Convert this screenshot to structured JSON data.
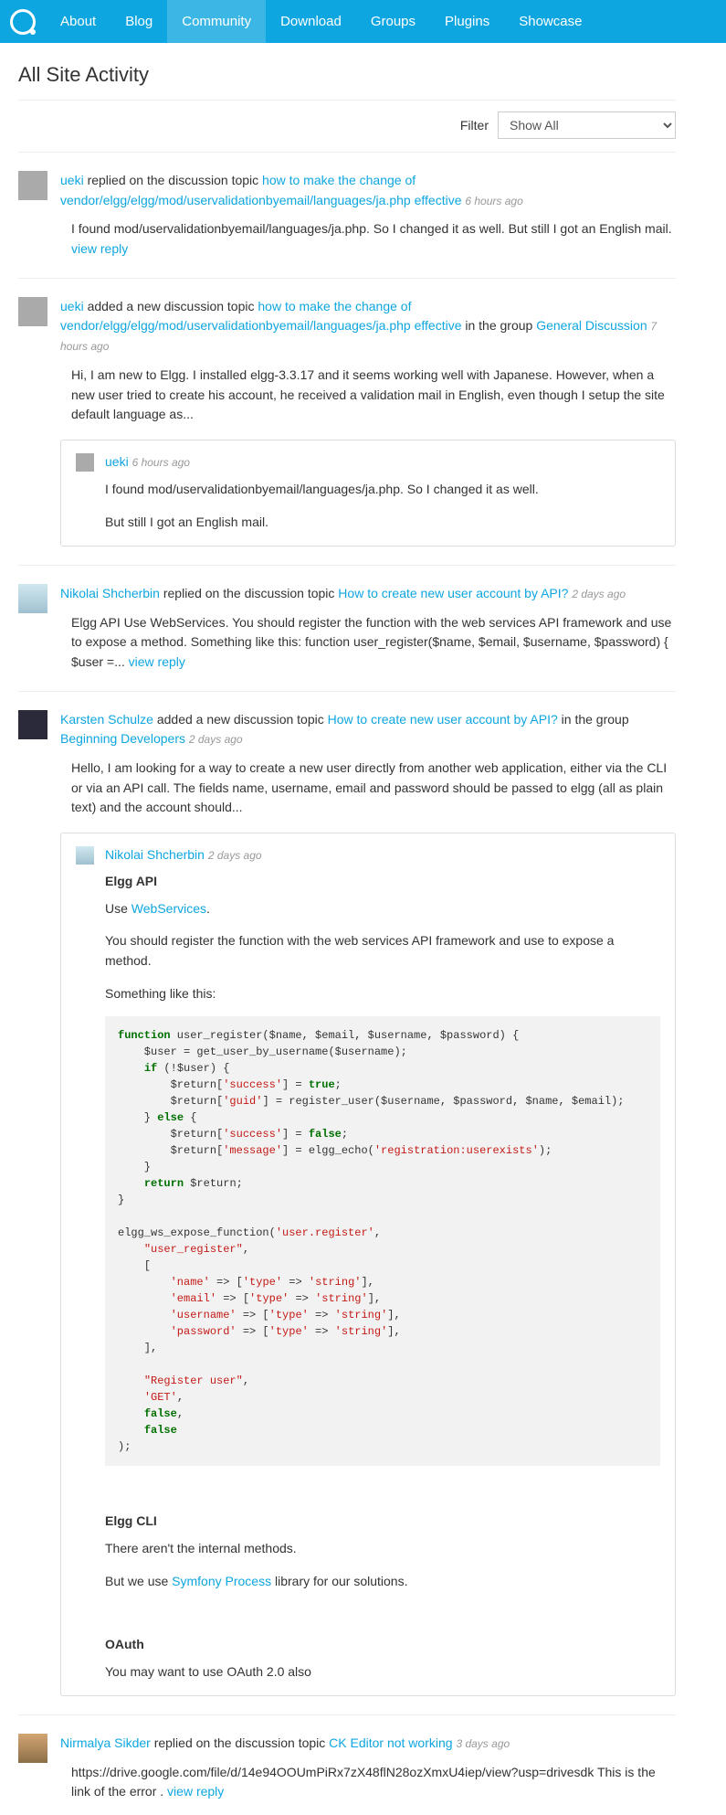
{
  "nav": {
    "items": [
      "About",
      "Blog",
      "Community",
      "Download",
      "Groups",
      "Plugins",
      "Showcase"
    ],
    "active_index": 2
  },
  "page_title": "All Site Activity",
  "filter": {
    "label": "Filter",
    "selected": "Show All"
  },
  "activity": [
    {
      "avatar": "default",
      "user": "ueki",
      "action": " replied on the discussion topic ",
      "topic": "how to make the change of vendor/elgg/elgg/mod/uservalidationbyemail/languages/ja.php effective",
      "time": "6 hours ago",
      "excerpt_pre": "I found mod/uservalidationbyemail/languages/ja.php. So I changed it as well. But still I got an English mail. ",
      "view_reply": "view reply"
    },
    {
      "avatar": "default",
      "user": "ueki",
      "action": " added a new discussion topic ",
      "topic": "how to make the change of vendor/elgg/elgg/mod/uservalidationbyemail/languages/ja.php effective",
      "tail": " in the group ",
      "group": "General Discussion",
      "time": "7 hours ago",
      "excerpt": "Hi, I am new to Elgg. I installed elgg-3.3.17 and it seems working well with Japanese. However, when a new user tried to create his account, he received a validation mail in English, even though I setup the site default language as...",
      "comment": {
        "avatar": "default",
        "user": "ueki",
        "time": "6 hours ago",
        "lines": [
          "I found mod/uservalidationbyemail/languages/ja.php. So I changed it as well.",
          "But still I got an English mail."
        ]
      }
    },
    {
      "avatar": "blue-glasses",
      "user": "Nikolai Shcherbin",
      "action": " replied on the discussion topic ",
      "topic": "How to create new user account by API?",
      "time": "2 days ago",
      "excerpt_pre": "Elgg API Use WebServices. You should register the function with the web services API framework and use to expose a method. Something like this: function user_register($name, $email, $username, $password) { $user =... ",
      "view_reply": "view reply"
    },
    {
      "avatar": "dark",
      "user": "Karsten Schulze",
      "action": " added a new discussion topic ",
      "topic": "How to create new user account by API?",
      "tail": " in the group ",
      "group": "Beginning Developers",
      "time": "2 days ago",
      "excerpt": "Hello, I am looking for a way to create a new user directly from another web application, either via the CLI or via an API call. The fields name, username, email and password should be passed to elgg (all as plain text) and the account should...",
      "rich_comment": {
        "avatar": "blue-glasses",
        "user": "Nikolai Shcherbin",
        "time": "2 days ago",
        "h_api": "Elgg API",
        "use_text": "Use ",
        "webservices": "WebServices",
        "period": ".",
        "p_register": "You should register the function with the web services API framework and use to expose a method.",
        "p_something": "Something like this:",
        "h_cli": "Elgg CLI",
        "p_internal": "There aren't the internal methods.",
        "p_butwe": "But we use ",
        "symfony": "Symfony Process",
        "p_butwe2": " library for our solutions.",
        "h_oauth": "OAuth",
        "p_oauth": "You may want to use OAuth 2.0 also"
      }
    },
    {
      "avatar": "person",
      "user": "Nirmalya Sikder",
      "action": " replied on the discussion topic ",
      "topic": "CK Editor not working",
      "time": "3 days ago",
      "excerpt_pre": "https://drive.google.com/file/d/14e94OOUmPiRx7zX48flN28ozXmxU4iep/view?usp=drivesdk This is the link of the error . ",
      "view_reply": "view reply"
    }
  ]
}
